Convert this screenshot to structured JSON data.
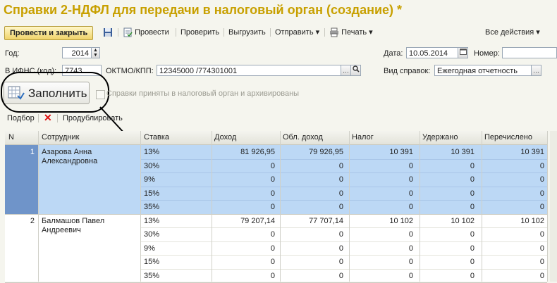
{
  "window": {
    "title": "Справки 2-НДФЛ для передачи в налоговый орган (создание) *"
  },
  "toolbar": {
    "post_close": "Провести и закрыть",
    "post": "Провести",
    "check": "Проверить",
    "export": "Выгрузить",
    "send": "Отправить",
    "print": "Печать",
    "all_actions": "Все действия"
  },
  "form": {
    "year_label": "Год:",
    "year_value": "2014",
    "date_label": "Дата:",
    "date_value": "10.05.2014",
    "number_label": "Номер:",
    "number_value": "",
    "ifns_label": "В ИФНС (код):",
    "ifns_value": "7743",
    "oktmo_label": "ОКТМО/КПП:",
    "oktmo_value": "12345000   /774301001",
    "type_label": "Вид справок:",
    "type_value": "Ежегодная отчетность",
    "fill_button": "Заполнить",
    "accepted_checkbox": "Справки приняты в налоговый орган и архивированы"
  },
  "subtoolbar": {
    "select": "Подбор",
    "duplicate": "Продублировать"
  },
  "table": {
    "headers": [
      "N",
      "Сотрудник",
      "Ставка",
      "Доход",
      "Обл. доход",
      "Налог",
      "Удержано",
      "Перечислено"
    ],
    "employees": [
      {
        "n": "1",
        "name_line1": "Азарова Анна",
        "name_line2": "Александровна",
        "selected": true,
        "rows": [
          {
            "rate": "13%",
            "income": "81 926,95",
            "taxable": "79 926,95",
            "tax": "10 391",
            "withheld": "10 391",
            "transferred": "10 391"
          },
          {
            "rate": "30%",
            "income": "0",
            "taxable": "0",
            "tax": "0",
            "withheld": "0",
            "transferred": "0"
          },
          {
            "rate": "9%",
            "income": "0",
            "taxable": "0",
            "tax": "0",
            "withheld": "0",
            "transferred": "0"
          },
          {
            "rate": "15%",
            "income": "0",
            "taxable": "0",
            "tax": "0",
            "withheld": "0",
            "transferred": "0"
          },
          {
            "rate": "35%",
            "income": "0",
            "taxable": "0",
            "tax": "0",
            "withheld": "0",
            "transferred": "0"
          }
        ]
      },
      {
        "n": "2",
        "name_line1": "Балмашов Павел",
        "name_line2": "Андреевич",
        "selected": false,
        "rows": [
          {
            "rate": "13%",
            "income": "79 207,14",
            "taxable": "77 707,14",
            "tax": "10 102",
            "withheld": "10 102",
            "transferred": "10 102"
          },
          {
            "rate": "30%",
            "income": "0",
            "taxable": "0",
            "tax": "0",
            "withheld": "0",
            "transferred": "0"
          },
          {
            "rate": "9%",
            "income": "0",
            "taxable": "0",
            "tax": "0",
            "withheld": "0",
            "transferred": "0"
          },
          {
            "rate": "15%",
            "income": "0",
            "taxable": "0",
            "tax": "0",
            "withheld": "0",
            "transferred": "0"
          },
          {
            "rate": "35%",
            "income": "0",
            "taxable": "0",
            "tax": "0",
            "withheld": "0",
            "transferred": "0"
          }
        ]
      }
    ]
  },
  "colors": {
    "title": "#c8a000",
    "selection": "#bcd8f5",
    "selection_n": "#6f94c9",
    "accent": "#f0d36a"
  }
}
